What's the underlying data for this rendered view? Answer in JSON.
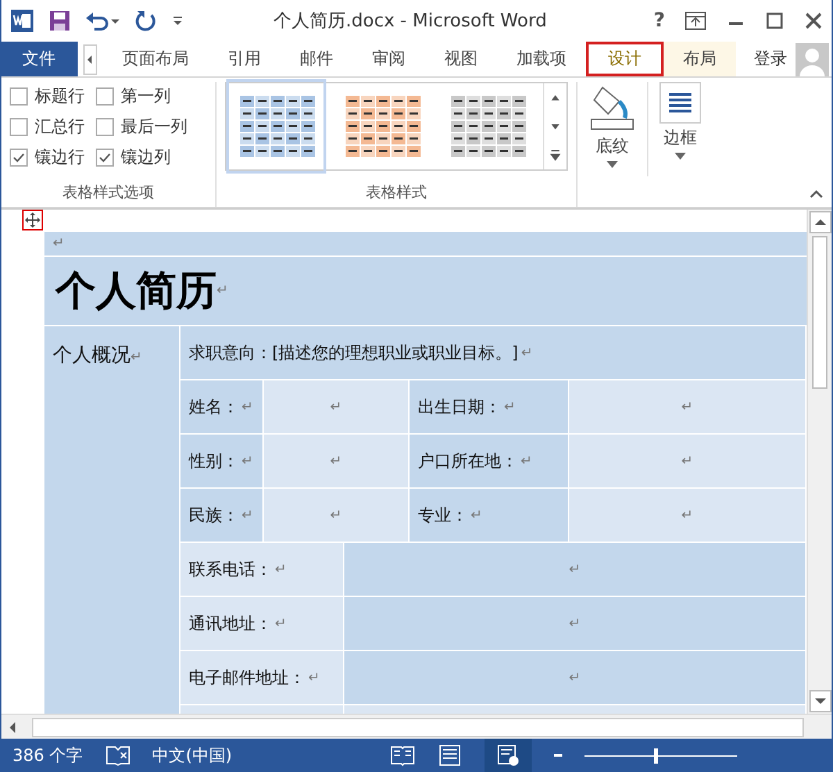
{
  "window": {
    "title": "个人简历.docx - Microsoft Word",
    "help": "?"
  },
  "tabs": [
    {
      "label": "文件",
      "kind": "file",
      "selected": false
    },
    {
      "label": "页面布局",
      "kind": "normal",
      "selected": false
    },
    {
      "label": "引用",
      "kind": "normal",
      "selected": false
    },
    {
      "label": "邮件",
      "kind": "normal",
      "selected": false
    },
    {
      "label": "审阅",
      "kind": "normal",
      "selected": false
    },
    {
      "label": "视图",
      "kind": "normal",
      "selected": false
    },
    {
      "label": "加载项",
      "kind": "normal",
      "selected": false
    },
    {
      "label": "设计",
      "kind": "contextual",
      "selected": true
    },
    {
      "label": "布局",
      "kind": "contextual",
      "selected": false
    }
  ],
  "sign_in": "登录",
  "ribbon": {
    "options": {
      "label": "表格样式选项",
      "checkboxes": [
        {
          "label": "标题行",
          "checked": false
        },
        {
          "label": "第一列",
          "checked": false
        },
        {
          "label": "汇总行",
          "checked": false
        },
        {
          "label": "最后一列",
          "checked": false
        },
        {
          "label": "镶边行",
          "checked": true
        },
        {
          "label": "镶边列",
          "checked": true
        }
      ]
    },
    "styles": {
      "label": "表格样式",
      "items": [
        {
          "color": "#a9c4e4",
          "selected": true
        },
        {
          "color": "#f4b993",
          "selected": false
        },
        {
          "color": "#c8c8c8",
          "selected": false
        }
      ]
    },
    "shading": {
      "label": "底纹"
    },
    "borders": {
      "label": "边框"
    }
  },
  "document": {
    "mark": "↵",
    "title": "个人简历",
    "section": {
      "label": "个人概况",
      "rows": [
        {
          "kind": "full",
          "cells": [
            "求职意向：[描述您的理想职业或职业目标。]"
          ]
        },
        {
          "kind": "pairs",
          "cells": [
            "姓名：",
            "",
            "出生日期：",
            ""
          ]
        },
        {
          "kind": "pairs",
          "cells": [
            "性别：",
            "",
            "户口所在地：",
            ""
          ]
        },
        {
          "kind": "pairs",
          "cells": [
            "民族：",
            "",
            "专业：",
            ""
          ]
        },
        {
          "kind": "single",
          "cells": [
            "联系电话：",
            ""
          ]
        },
        {
          "kind": "single",
          "cells": [
            "通讯地址：",
            ""
          ]
        },
        {
          "kind": "single",
          "cells": [
            "电子邮件地址：",
            ""
          ]
        }
      ]
    }
  },
  "status_bar": {
    "words": "386 个字",
    "language": "中文(中国)",
    "zoom": {
      "level": 0.45
    }
  }
}
